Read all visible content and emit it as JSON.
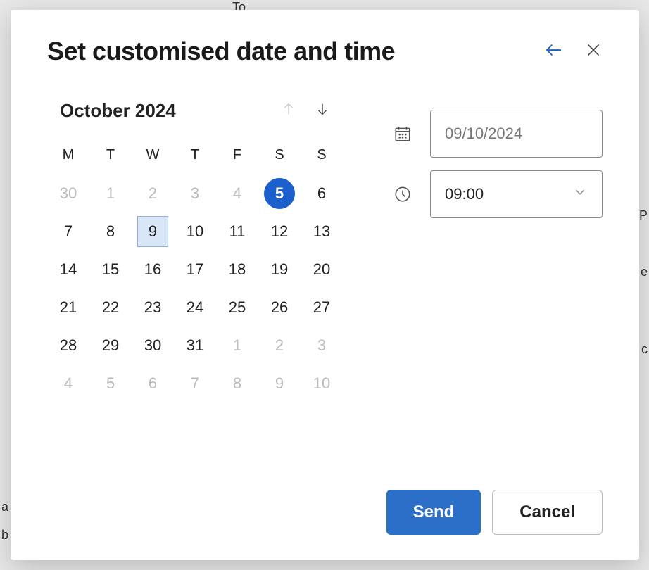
{
  "dialog": {
    "title": "Set customised date and time"
  },
  "calendar": {
    "month_year": "October 2024",
    "day_headers": [
      "M",
      "T",
      "W",
      "T",
      "F",
      "S",
      "S"
    ],
    "weeks": [
      [
        {
          "d": "30",
          "other": true
        },
        {
          "d": "1",
          "other": true
        },
        {
          "d": "2",
          "other": true
        },
        {
          "d": "3",
          "other": true
        },
        {
          "d": "4",
          "other": true
        },
        {
          "d": "5",
          "today": true
        },
        {
          "d": "6"
        }
      ],
      [
        {
          "d": "7"
        },
        {
          "d": "8"
        },
        {
          "d": "9",
          "selected": true
        },
        {
          "d": "10"
        },
        {
          "d": "11"
        },
        {
          "d": "12"
        },
        {
          "d": "13"
        }
      ],
      [
        {
          "d": "14"
        },
        {
          "d": "15"
        },
        {
          "d": "16"
        },
        {
          "d": "17"
        },
        {
          "d": "18"
        },
        {
          "d": "19"
        },
        {
          "d": "20"
        }
      ],
      [
        {
          "d": "21"
        },
        {
          "d": "22"
        },
        {
          "d": "23"
        },
        {
          "d": "24"
        },
        {
          "d": "25"
        },
        {
          "d": "26"
        },
        {
          "d": "27"
        }
      ],
      [
        {
          "d": "28"
        },
        {
          "d": "29"
        },
        {
          "d": "30"
        },
        {
          "d": "31"
        },
        {
          "d": "1",
          "other": true
        },
        {
          "d": "2",
          "other": true
        },
        {
          "d": "3",
          "other": true
        }
      ],
      [
        {
          "d": "4",
          "other": true
        },
        {
          "d": "5",
          "other": true
        },
        {
          "d": "6",
          "other": true
        },
        {
          "d": "7",
          "other": true
        },
        {
          "d": "8",
          "other": true
        },
        {
          "d": "9",
          "other": true
        },
        {
          "d": "10",
          "other": true
        }
      ]
    ]
  },
  "inputs": {
    "date_value": "09/10/2024",
    "time_value": "09:00"
  },
  "buttons": {
    "send": "Send",
    "cancel": "Cancel"
  },
  "backdrop": {
    "to": "To",
    "a": "a",
    "b": "b",
    "p": "P",
    "e": "e",
    "c": "c"
  }
}
